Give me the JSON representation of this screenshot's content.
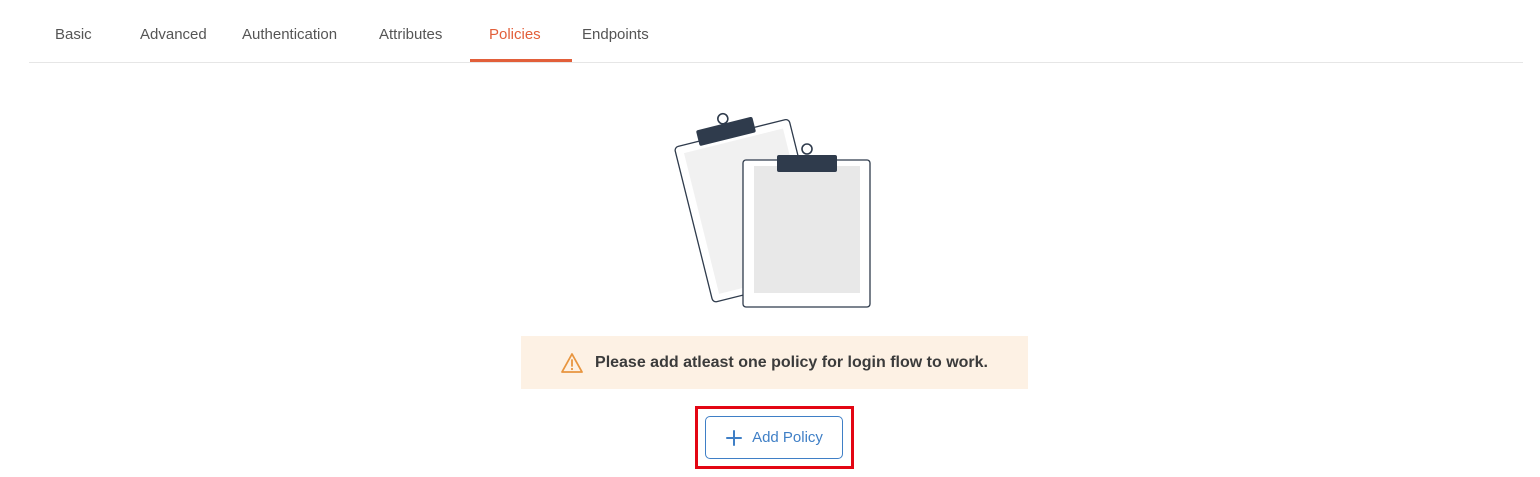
{
  "tabs": [
    {
      "label": "Basic",
      "active": false
    },
    {
      "label": "Advanced",
      "active": false
    },
    {
      "label": "Authentication",
      "active": false
    },
    {
      "label": "Attributes",
      "active": false
    },
    {
      "label": "Policies",
      "active": true
    },
    {
      "label": "Endpoints",
      "active": false
    }
  ],
  "empty_state": {
    "illustration": "clipboard-icon",
    "warning_icon": "warning-triangle-icon",
    "warning_text": "Please add atleast one policy for login flow to work.",
    "add_button_icon": "plus-icon",
    "add_button_label": "Add Policy"
  },
  "colors": {
    "accent": "#e25f3a",
    "warning_bg": "#fdf1e4",
    "warning_icon": "#e8953f",
    "button": "#3f7fc6",
    "highlight": "#e30613"
  }
}
